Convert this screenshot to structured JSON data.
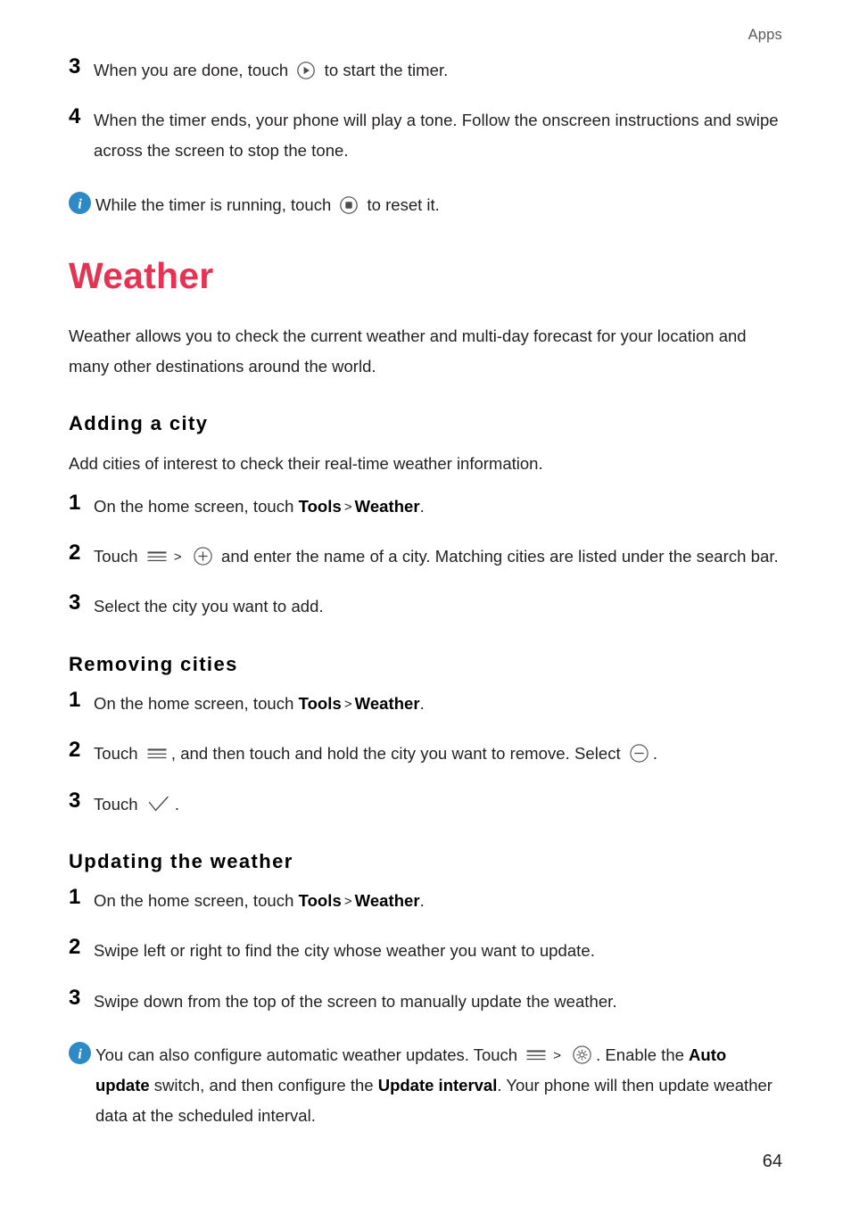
{
  "header": {
    "running_head": "Apps"
  },
  "footer": {
    "page_number": "64"
  },
  "colors": {
    "chapter_heading": "#e63253",
    "info_badge": "#2d8ac7",
    "body_text": "#231f20",
    "running_head": "#58595b"
  },
  "timer_steps": {
    "step3": {
      "number": "3",
      "text_before": "When you are done, touch",
      "icon": "play-circle-icon",
      "text_after": "to start the timer."
    },
    "step4": {
      "number": "4",
      "text": "When the timer ends, your phone will play a tone. Follow the onscreen instructions and swipe across the screen to stop the tone."
    },
    "note": {
      "icon": "info-icon",
      "text_before": "While the timer is running, touch",
      "icon_inline": "stop-circle-icon",
      "text_after": "to reset it."
    }
  },
  "weather": {
    "title": "Weather",
    "intro": "Weather allows you to check the current weather and multi-day forecast for your location and many other destinations around the world.",
    "sections": [
      {
        "heading": "Adding a city",
        "lead": "Add cities of interest to check their real-time weather information.",
        "steps": [
          {
            "number": "1",
            "prefix": "On the home screen, touch",
            "bold1": "Tools",
            "separator": ">",
            "bold2": "Weather",
            "suffix": "."
          },
          {
            "number": "2",
            "prefix": "Touch",
            "icon1": "hamburger-menu-icon",
            "separator": ">",
            "icon2": "add-circle-icon",
            "suffix": "and enter the name of a city. Matching cities are listed under the search bar."
          },
          {
            "number": "3",
            "text": "Select the city you want to add."
          }
        ]
      },
      {
        "heading": "Removing cities",
        "steps": [
          {
            "number": "1",
            "prefix": "On the home screen, touch",
            "bold1": "Tools",
            "separator": ">",
            "bold2": "Weather",
            "suffix": "."
          },
          {
            "number": "2",
            "prefix": "Touch",
            "icon1": "hamburger-menu-icon",
            "mid": ", and then touch and hold the city you want to remove. Select",
            "icon2": "remove-circle-icon",
            "suffix": "."
          },
          {
            "number": "3",
            "prefix": "Touch",
            "icon1": "checkmark-icon",
            "suffix": "."
          }
        ]
      },
      {
        "heading": "Updating the weather",
        "steps": [
          {
            "number": "1",
            "prefix": "On the home screen, touch",
            "bold1": "Tools",
            "separator": ">",
            "bold2": "Weather",
            "suffix": "."
          },
          {
            "number": "2",
            "text": "Swipe left or right to find the city whose weather you want to update."
          },
          {
            "number": "3",
            "text": "Swipe down from the top of the screen to manually update the weather."
          }
        ],
        "note": {
          "icon": "info-icon",
          "part1": "You can also configure automatic weather updates. Touch",
          "icon1": "hamburger-menu-icon",
          "separator": ">",
          "icon2": "settings-gear-circle-icon",
          "part2": ". Enable the",
          "bold1": "Auto update",
          "part3": "switch, and then configure the",
          "bold2": "Update interval",
          "part4": ". Your phone will then update weather data at the scheduled interval."
        }
      }
    ]
  }
}
